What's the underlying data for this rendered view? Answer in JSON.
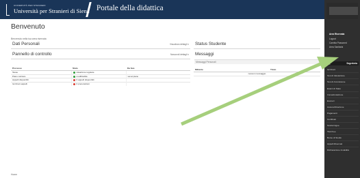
{
  "header": {
    "university_small": "UNIVERSITÀ PER STRANIERI",
    "university_name": "Università per Stranieri di Siena",
    "portal_title": "Portale della didattica"
  },
  "page": {
    "title": "Benvenuto",
    "subtitle": "Benvenuto nella tua area riservata"
  },
  "panels": {
    "dati_personali": {
      "title": "Dati Personali",
      "action": "Visualizza dettagli ▾"
    },
    "pannello": {
      "title": "Pannello di controllo",
      "action": "Nascondi dettagli ▾"
    },
    "status": {
      "title": "Status Studente"
    },
    "messaggi": {
      "title": "Messaggi",
      "subtitle": "Messaggi Personali"
    }
  },
  "processi_table": {
    "headers": [
      "Processo",
      "Stato",
      "Da fare"
    ],
    "rows": [
      {
        "processo": "Tasse",
        "stato": "situazione regolare",
        "color": "#2e9e3a",
        "da_fare": ""
      },
      {
        "processo": "Piano carriera",
        "stato": "modificabile",
        "color": "#2e9e3a",
        "da_fare": "vai al piano"
      },
      {
        "processo": "Appelli disponibili",
        "stato": "0 appelli disponibili",
        "color": "#d83a2f",
        "da_fare": ""
      },
      {
        "processo": "Iscrizioni appelli",
        "stato": "0 prenotazioni",
        "color": "#d83a2f",
        "da_fare": ""
      }
    ]
  },
  "messaggi_table": {
    "headers": [
      "Mittente",
      "Titolo"
    ],
    "empty_text": "nessun messaggio"
  },
  "footer": {
    "text": "Home"
  },
  "sidebar": {
    "user_lines": [
      "Area Riservata",
      "Logout",
      "Cambia Password",
      "Area Sanitaria"
    ],
    "menu_close": "X",
    "menu_label": "Segreteria",
    "items": [
      "Iscrizioni",
      "Test di Valutazione",
      "Test di Ammissione",
      "Esami di Stato",
      "Immatricolazione",
      "Esoneri",
      "Autocertificazione",
      "Pagamenti",
      "Certificati",
      "Scelta lingue",
      "Titoli Fee",
      "Borse di Studio",
      "Appelli Riservati",
      "Dichiarazione Invalidità"
    ]
  },
  "colors": {
    "header_bg": "#1a3558",
    "sidebar_bg": "#2f2f2f",
    "arrow": "#a6cf7c",
    "ok": "#2e9e3a",
    "warn": "#d83a2f"
  }
}
